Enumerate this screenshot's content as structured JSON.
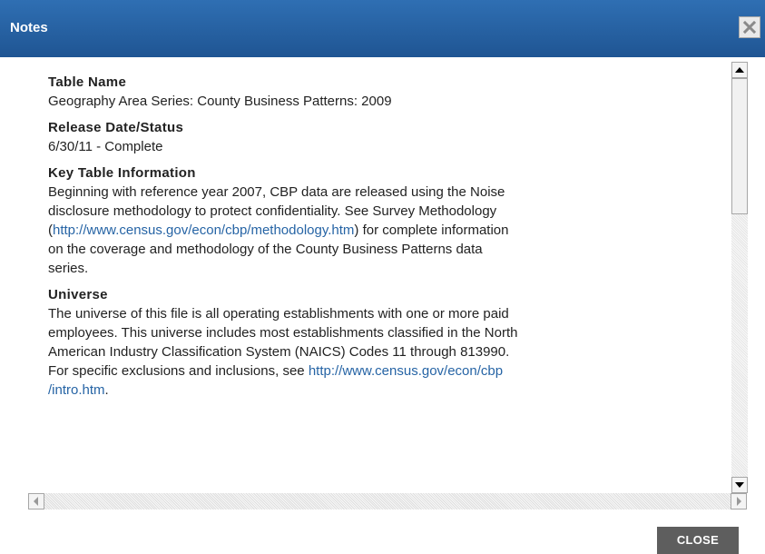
{
  "dialog": {
    "title": "Notes",
    "close_button_label": "CLOSE",
    "close_icon": "close-x-icon"
  },
  "sections": [
    {
      "label": "Table Name",
      "text": "Geography Area Series: County Business Patterns: 2009"
    },
    {
      "label": "Release Date/Status",
      "text": "6/30/11 - Complete"
    },
    {
      "label": "Key Table Information",
      "text_before": "Beginning with reference year 2007, CBP data are released using the Noise\ndisclosure methodology to protect confidentiality. See Survey Methodology\n(",
      "link": "http://www.census.gov/econ/cbp/methodology.htm",
      "text_after": ") for complete information\non the coverage and methodology of the County Business Patterns data\nseries."
    },
    {
      "label": "Universe",
      "text_before": "The universe of this file is all operating establishments with one or more paid\nemployees. This universe includes most establishments classified in the North\nAmerican Industry Classification System (NAICS) Codes 11 through 813990.\nFor specific exclusions and inclusions, see ",
      "link": "http://www.census.gov/econ/cbp\n/intro.htm",
      "text_after": "."
    }
  ],
  "colors": {
    "titlebar": "#2f6fb3",
    "link": "#2664a5",
    "close_button": "#5e5e5e"
  }
}
